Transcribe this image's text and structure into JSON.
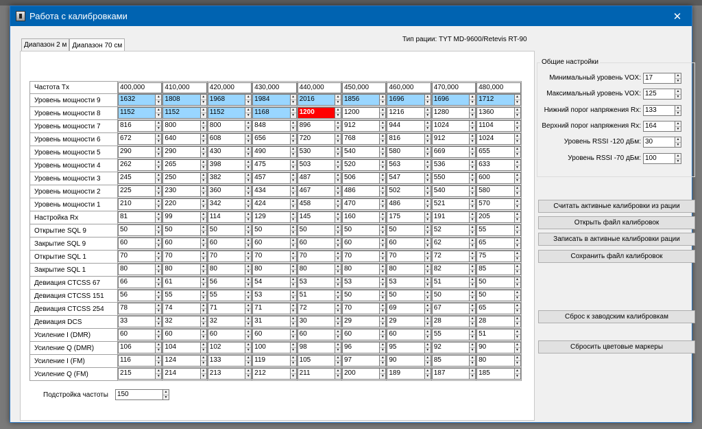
{
  "window": {
    "title": "Работа с калибровками",
    "close_glyph": "✕",
    "icon": "app-radio-icon"
  },
  "tabs": [
    {
      "label": "Диапазон 2 м",
      "active": false
    },
    {
      "label": "Диапазон 70 см",
      "active": true
    }
  ],
  "radio_type": "Тип рации: TYT MD-9600/Retevis RT-90",
  "table": {
    "frequencies_label": "Частота Tx",
    "frequencies": [
      "400,000",
      "410,000",
      "420,000",
      "430,000",
      "440,000",
      "450,000",
      "460,000",
      "470,000",
      "480,000"
    ],
    "rows": [
      {
        "label": "Уровень мощности 9",
        "values": [
          "1632",
          "1808",
          "1968",
          "1984",
          "2016",
          "1856",
          "1696",
          "1696",
          "1712"
        ],
        "highlight": [
          "blue",
          "blue",
          "blue",
          "blue",
          "blue",
          "blue",
          "blue",
          "blue",
          "blue"
        ]
      },
      {
        "label": "Уровень мощности 8",
        "values": [
          "1152",
          "1152",
          "1152",
          "1168",
          "1200",
          "1200",
          "1216",
          "1280",
          "1360"
        ],
        "highlight": [
          "blue",
          "blue",
          "blue",
          "blue",
          "red",
          "",
          "",
          "",
          ""
        ]
      },
      {
        "label": "Уровень мощности 7",
        "values": [
          "816",
          "800",
          "800",
          "848",
          "896",
          "912",
          "944",
          "1024",
          "1104"
        ]
      },
      {
        "label": "Уровень мощности 6",
        "values": [
          "672",
          "640",
          "608",
          "656",
          "720",
          "768",
          "816",
          "912",
          "1024"
        ]
      },
      {
        "label": "Уровень мощности 5",
        "values": [
          "290",
          "290",
          "430",
          "490",
          "530",
          "540",
          "580",
          "669",
          "655"
        ]
      },
      {
        "label": "Уровень мощности 4",
        "values": [
          "262",
          "265",
          "398",
          "475",
          "503",
          "520",
          "563",
          "536",
          "633"
        ]
      },
      {
        "label": "Уровень мощности 3",
        "values": [
          "245",
          "250",
          "382",
          "457",
          "487",
          "506",
          "547",
          "550",
          "600"
        ]
      },
      {
        "label": "Уровень мощности 2",
        "values": [
          "225",
          "230",
          "360",
          "434",
          "467",
          "486",
          "502",
          "540",
          "580"
        ]
      },
      {
        "label": "Уровень мощности 1",
        "values": [
          "210",
          "220",
          "342",
          "424",
          "458",
          "470",
          "486",
          "521",
          "570"
        ]
      },
      {
        "label": "Настройка Rx",
        "values": [
          "81",
          "99",
          "114",
          "129",
          "145",
          "160",
          "175",
          "191",
          "205"
        ]
      },
      {
        "label": "Открытие SQL 9",
        "values": [
          "50",
          "50",
          "50",
          "50",
          "50",
          "50",
          "50",
          "52",
          "55"
        ]
      },
      {
        "label": "Закрытие SQL 9",
        "values": [
          "60",
          "60",
          "60",
          "60",
          "60",
          "60",
          "60",
          "62",
          "65"
        ]
      },
      {
        "label": "Открытие SQL 1",
        "values": [
          "70",
          "70",
          "70",
          "70",
          "70",
          "70",
          "70",
          "72",
          "75"
        ]
      },
      {
        "label": "Закрытие SQL 1",
        "values": [
          "80",
          "80",
          "80",
          "80",
          "80",
          "80",
          "80",
          "82",
          "85"
        ]
      },
      {
        "label": "Девиация CTCSS 67",
        "values": [
          "66",
          "61",
          "56",
          "54",
          "53",
          "53",
          "53",
          "51",
          "50"
        ]
      },
      {
        "label": "Девиация CTCSS 151",
        "values": [
          "56",
          "55",
          "55",
          "53",
          "51",
          "50",
          "50",
          "50",
          "50"
        ]
      },
      {
        "label": "Девиация CTCSS 254",
        "values": [
          "78",
          "74",
          "71",
          "71",
          "72",
          "70",
          "69",
          "67",
          "65"
        ]
      },
      {
        "label": "Девиация DCS",
        "values": [
          "33",
          "32",
          "32",
          "31",
          "30",
          "29",
          "29",
          "28",
          "28"
        ]
      },
      {
        "label": "Усиление I (DMR)",
        "values": [
          "60",
          "60",
          "60",
          "60",
          "60",
          "60",
          "60",
          "55",
          "51"
        ]
      },
      {
        "label": "Усиление Q (DMR)",
        "values": [
          "106",
          "104",
          "102",
          "100",
          "98",
          "96",
          "95",
          "92",
          "90"
        ]
      },
      {
        "label": "Усиление I (FM)",
        "values": [
          "116",
          "124",
          "133",
          "119",
          "105",
          "97",
          "90",
          "85",
          "80"
        ]
      },
      {
        "label": "Усиление Q (FM)",
        "values": [
          "215",
          "214",
          "213",
          "212",
          "211",
          "200",
          "189",
          "187",
          "185"
        ]
      }
    ]
  },
  "freq_adjust": {
    "label": "Подстройка частоты",
    "value": "150"
  },
  "settings": {
    "legend": "Общие настройки",
    "items": [
      {
        "label": "Минимальный уровень VOX:",
        "value": "17"
      },
      {
        "label": "Максимальный уровень VOX:",
        "value": "125"
      },
      {
        "label": "Нижний порог напряжения Rx:",
        "value": "133"
      },
      {
        "label": "Верхний порог напряжения Rx:",
        "value": "164"
      },
      {
        "label": "Уровень RSSI -120 дБм:",
        "value": "30"
      },
      {
        "label": "Уровень RSSI -70 дБм:",
        "value": "100"
      }
    ]
  },
  "buttons": {
    "read_active": "Считать активные калибровки из рации",
    "open_file": "Открыть файл калибровок",
    "write_active": "Записать в активные калибровки рации",
    "save_file": "Сохранить файл калибровок",
    "factory_reset": "Сброс к заводским калибровкам",
    "reset_markers": "Сбросить цветовые маркеры"
  },
  "colors": {
    "titlebar": "#0063b1",
    "marker_blue": "#99d6ff",
    "marker_red": "#ff0000"
  }
}
